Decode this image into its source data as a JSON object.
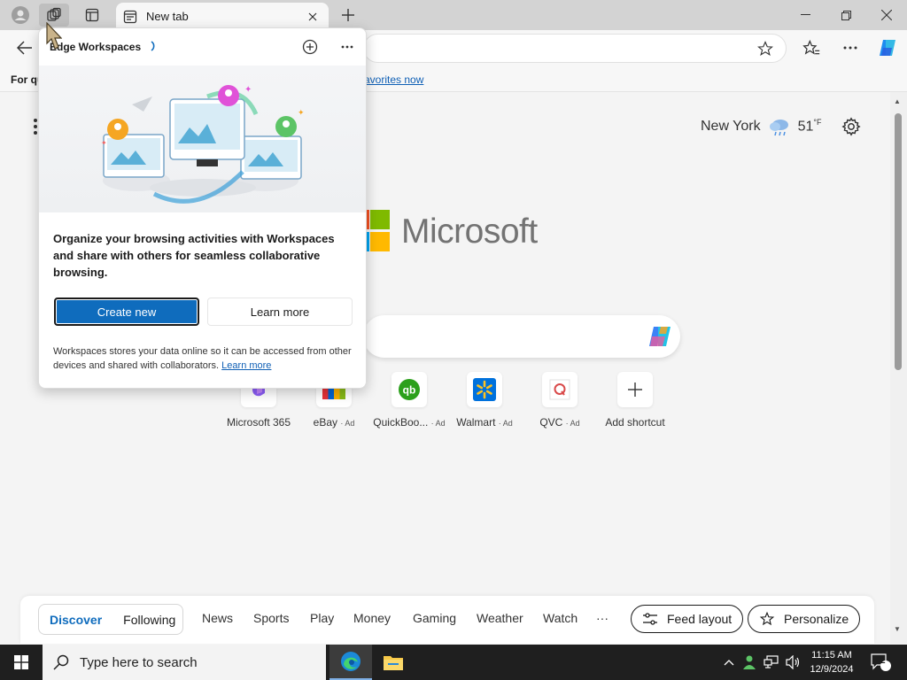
{
  "browser": {
    "active_tab": {
      "label": "New tab"
    },
    "favorites_bar": {
      "prefix": "For qu",
      "link": "avorites now"
    }
  },
  "workspaces_popup": {
    "title": "Edge Workspaces",
    "description": "Organize your browsing activities with Workspaces and share with others for seamless collaborative browsing.",
    "create_new_label": "Create new",
    "learn_more_label": "Learn more",
    "footer_text": "Workspaces stores your data online so it can be accessed from other devices and shared with collaborators.",
    "footer_link": "Learn more"
  },
  "new_tab_page": {
    "weather": {
      "city": "New York",
      "temp": "51",
      "unit": "°F"
    },
    "logo_text": "Microsoft",
    "shortcuts": [
      {
        "label": "Microsoft 365",
        "ad": ""
      },
      {
        "label": "eBay",
        "ad": "· Ad"
      },
      {
        "label": "QuickBoo...",
        "ad": "· Ad"
      },
      {
        "label": "Walmart",
        "ad": "· Ad"
      },
      {
        "label": "QVC",
        "ad": "· Ad"
      },
      {
        "label": "Add shortcut",
        "ad": ""
      }
    ],
    "feed": {
      "pill": [
        "Discover",
        "Following"
      ],
      "items": [
        "News",
        "Sports",
        "Play",
        "Money",
        "Gaming",
        "Weather",
        "Watch",
        "···"
      ],
      "feed_layout_label": "Feed layout",
      "personalize_label": "Personalize"
    }
  },
  "taskbar": {
    "search_placeholder": "Type here to search",
    "time": "11:15 AM",
    "date": "12/9/2024",
    "notification_count": "2"
  },
  "colors": {
    "accent": "#0f6cbd",
    "ms_red": "#f25022",
    "ms_green": "#7fba00",
    "ms_blue": "#00a4ef",
    "ms_yellow": "#ffb900"
  }
}
